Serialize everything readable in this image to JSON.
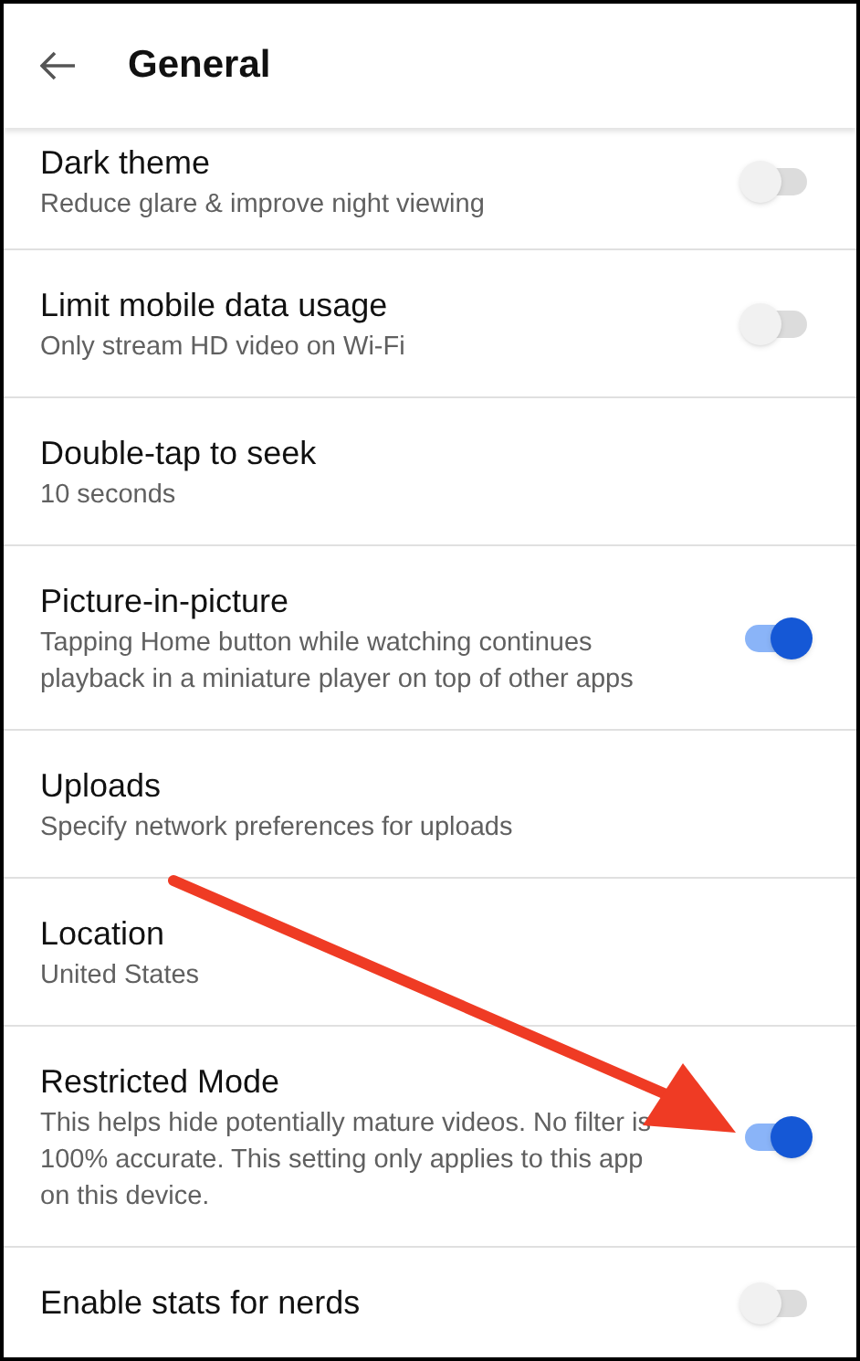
{
  "header": {
    "title": "General"
  },
  "settings": [
    {
      "kind": "toggle",
      "title": "Dark theme",
      "subtitle": "Reduce glare & improve night viewing",
      "on": false
    },
    {
      "kind": "toggle",
      "title": "Limit mobile data usage",
      "subtitle": "Only stream HD video on Wi-Fi",
      "on": false
    },
    {
      "kind": "plain",
      "title": "Double-tap to seek",
      "subtitle": "10 seconds"
    },
    {
      "kind": "toggle",
      "title": "Picture-in-picture",
      "subtitle": "Tapping Home button while watching continues playback in a miniature player on top of other apps",
      "on": true
    },
    {
      "kind": "plain",
      "title": "Uploads",
      "subtitle": "Specify network preferences for uploads"
    },
    {
      "kind": "plain",
      "title": "Location",
      "subtitle": "United States"
    },
    {
      "kind": "toggle",
      "title": "Restricted Mode",
      "subtitle": "This helps hide potentially mature videos. No filter is 100% accurate. This setting only applies to this app on this device.",
      "on": true
    },
    {
      "kind": "toggle",
      "title": "Enable stats for nerds",
      "on": false
    }
  ]
}
